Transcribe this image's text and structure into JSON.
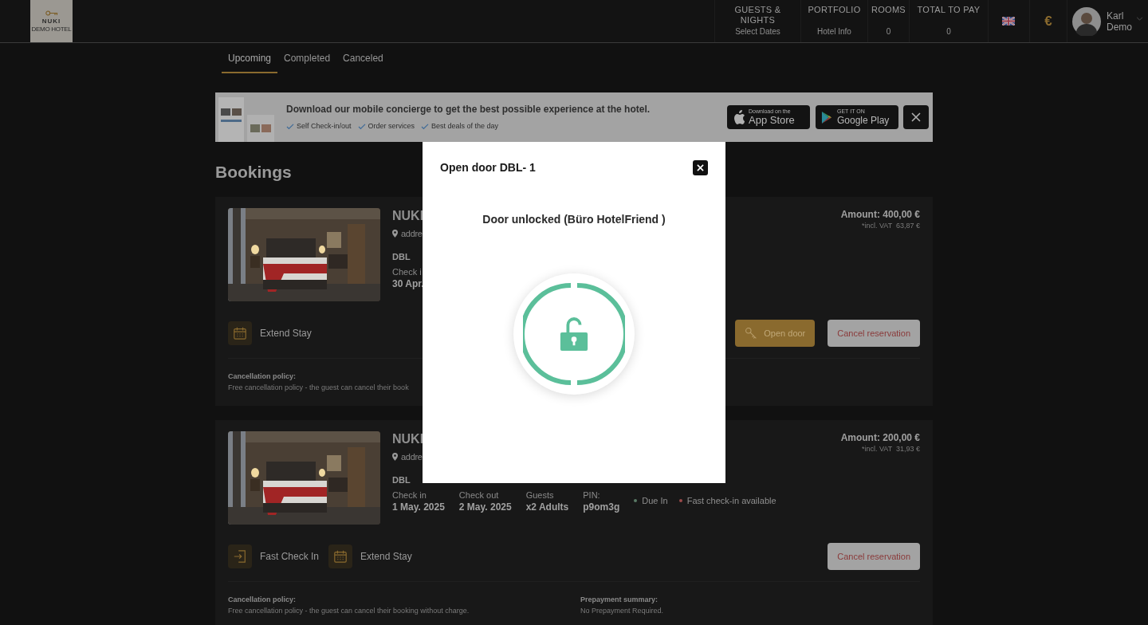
{
  "header": {
    "logo": {
      "name": "NUKI",
      "subtitle": "DEMO HOTEL"
    },
    "stats": [
      {
        "label": "GUESTS & NIGHTS",
        "value": "Select Dates"
      },
      {
        "label": "PORTFOLIO",
        "value": "Hotel Info"
      },
      {
        "label": "ROOMS",
        "value": "0"
      },
      {
        "label": "TOTAL TO PAY",
        "value": "0"
      }
    ],
    "currency": "€",
    "user": {
      "first_name": "Karl",
      "last_name": "Demo"
    }
  },
  "tabs": [
    {
      "label": "Upcoming",
      "selected": true
    },
    {
      "label": "Completed",
      "selected": false
    },
    {
      "label": "Canceled",
      "selected": false
    }
  ],
  "banner": {
    "headline": "Download our mobile concierge to get the best possible experience at the hotel.",
    "features": [
      "Self Check-in/out",
      "Order services",
      "Best deals of the day"
    ],
    "app_store": {
      "small": "Download on the",
      "big": "App Store"
    },
    "google_play": {
      "small": "GET IT ON",
      "big": "Google Play"
    }
  },
  "heading": "Bookings",
  "bookings": [
    {
      "hotel": "NUKI",
      "address": "addre",
      "room": "DBL",
      "details": [
        {
          "label": "Check i",
          "value": "30 Apr."
        }
      ],
      "amount": "Amount: 400,00 €",
      "vat": "*incl. VAT  63,87 €",
      "actions": [
        {
          "kind": "extend",
          "label": "Extend Stay"
        }
      ],
      "buttons": [
        {
          "kind": "open_door",
          "label": "Open door"
        },
        {
          "kind": "cancel",
          "label": "Cancel reservation"
        }
      ],
      "policy": {
        "title": "Cancellation policy:",
        "text": "Free cancellation policy - the guest can cancel their book"
      }
    },
    {
      "hotel": "NUKI",
      "address": "addre",
      "room": "DBL",
      "details": [
        {
          "label": "Check in",
          "value": "1 May. 2025"
        },
        {
          "label": "Check out",
          "value": "2 May. 2025"
        },
        {
          "label": "Guests",
          "value": "x2 Adults"
        },
        {
          "label": "PIN:",
          "value": "p9om3g"
        }
      ],
      "statuses": [
        {
          "label": "Due In",
          "color": "#5a7a66"
        },
        {
          "label": "Fast check-in available",
          "color": "#9b4a4a"
        }
      ],
      "amount": "Amount: 200,00 €",
      "vat": "*incl. VAT  31,93 €",
      "actions": [
        {
          "kind": "check_in",
          "label": "Fast Check In"
        },
        {
          "kind": "extend",
          "label": "Extend Stay"
        }
      ],
      "buttons": [
        {
          "kind": "cancel",
          "label": "Cancel reservation"
        }
      ],
      "policy": {
        "title": "Cancellation policy:",
        "text": "Free cancellation policy - the guest can cancel their booking without charge."
      },
      "prepayment": {
        "title": "Prepayment summary:",
        "text": "No Prepayment Required."
      }
    }
  ],
  "modal": {
    "title": "Open door DBL- 1",
    "message": "Door unlocked (Büro HotelFriend )",
    "unlocked": true
  }
}
